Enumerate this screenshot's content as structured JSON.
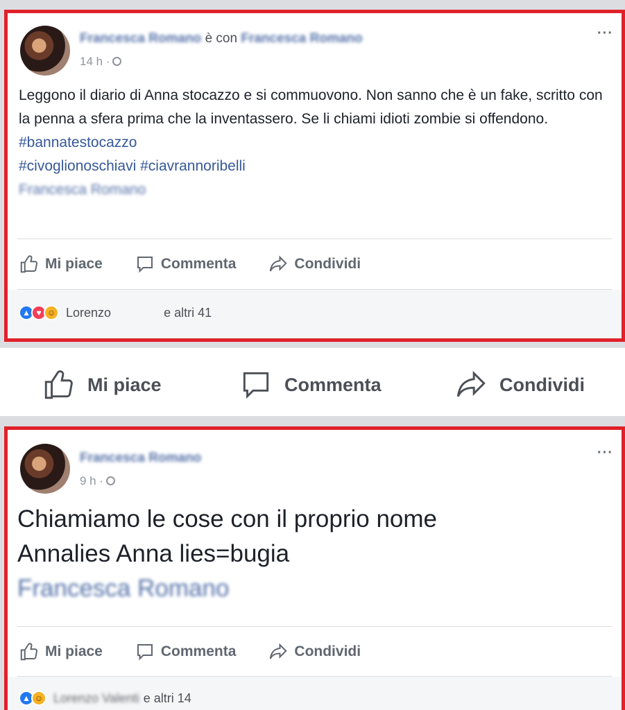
{
  "posts": [
    {
      "author": "Francesca Romano",
      "with_text": "è con",
      "tagged": "Francesca Romano",
      "time": "14 h ·",
      "body_text": "Leggono il diario di Anna stocazzo e si commuovono. Non sanno che è un fake, scritto con la penna a sfera prima che la inventassero. Se li chiami idioti zombie si offendono.",
      "hashtags": [
        "#bannatestocazzo",
        "#civoglionoschiavi #ciavrannoribelli"
      ],
      "signature": "Francesca Romano",
      "actions": {
        "like": "Mi piace",
        "comment": "Commenta",
        "share": "Condividi"
      },
      "reactions": {
        "name": "Lorenzo",
        "others": "e altri 41"
      }
    },
    {
      "author": "Francesca Romano",
      "time": "9 h ·",
      "body_lines": [
        "Chiamiamo le cose con il proprio nome",
        "Annalies Anna lies=bugia"
      ],
      "signature": "Francesca Romano",
      "actions": {
        "like": "Mi piace",
        "comment": "Commenta",
        "share": "Condividi"
      },
      "reactions": {
        "name": "Lorenzo Valenti",
        "others": "e altri 14"
      }
    }
  ],
  "midbar": {
    "like": "Mi piace",
    "comment": "Commenta",
    "share": "Condividi"
  },
  "icons": {
    "more": "more-options-icon",
    "like": "thumbs-up-icon",
    "comment": "comment-bubble-icon",
    "share": "share-arrow-icon",
    "globe": "globe-icon"
  },
  "colors": {
    "highlight_border": "#e0202a",
    "link": "#365899",
    "like_reaction": "#2078f4",
    "love_reaction": "#f33e58",
    "haha_reaction": "#f7b125"
  }
}
